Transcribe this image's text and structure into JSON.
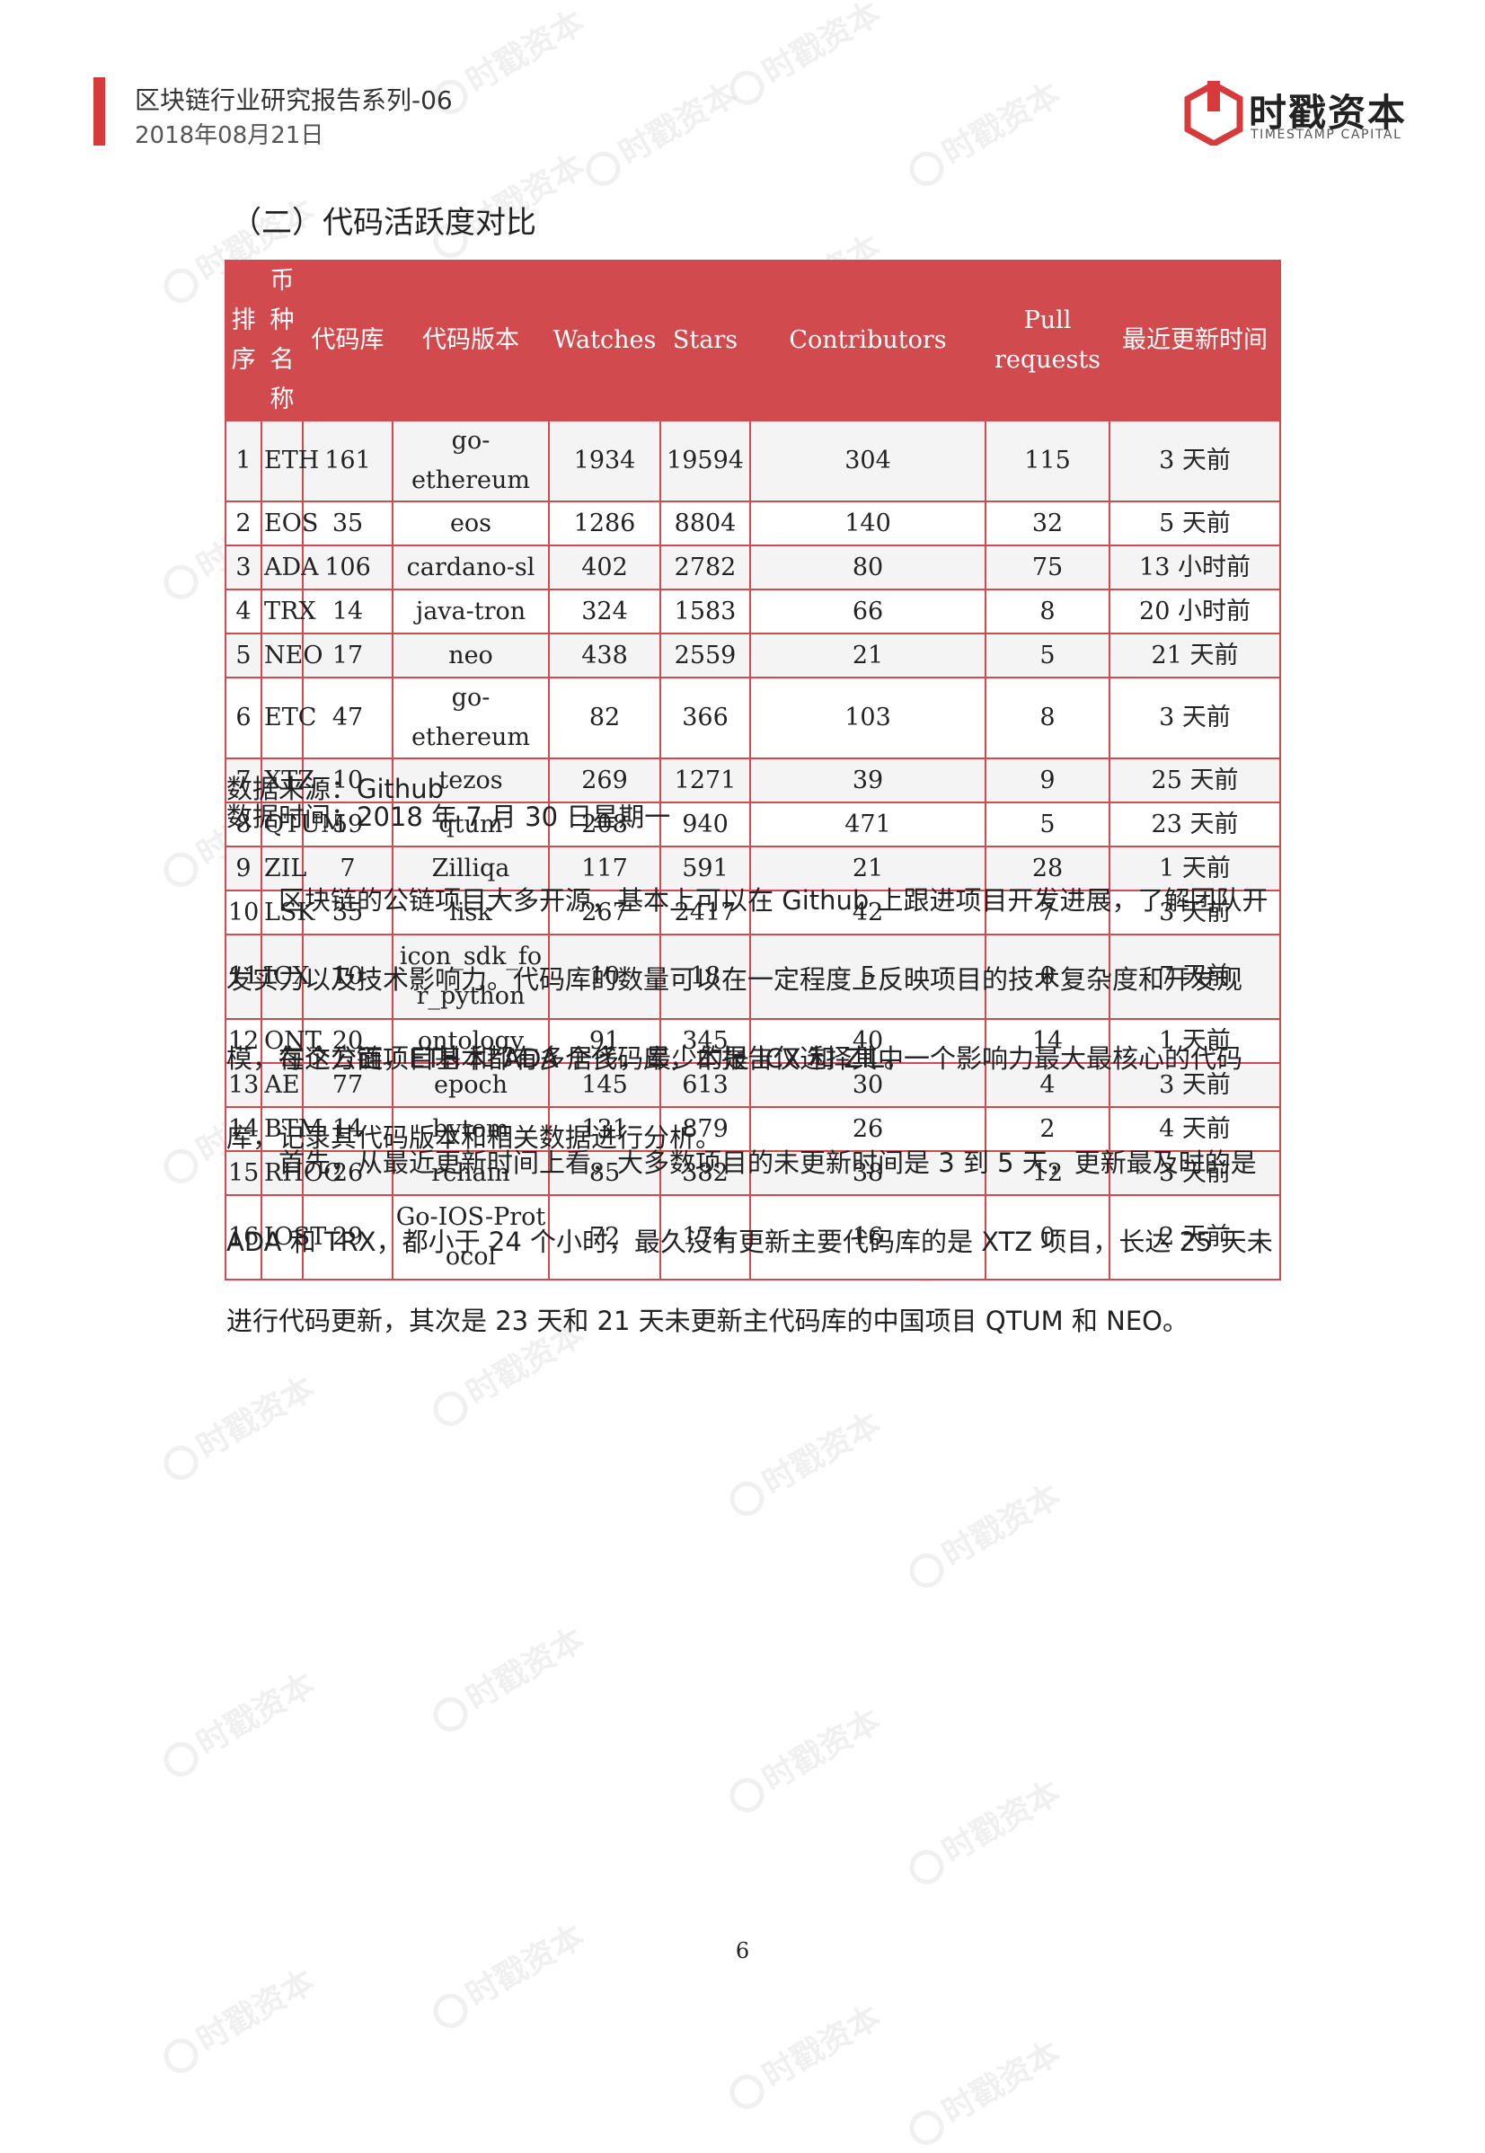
{
  "header": {
    "report_title": "区块链行业研究报告系列-06",
    "report_date": "2018年08月21日",
    "logo_text": "时戳资本",
    "logo_sub": "TIMESTAMP CAPITAL",
    "accent_color": "#d63a3a"
  },
  "section": {
    "heading": "（二）代码活跃度对比"
  },
  "table": {
    "headers": {
      "rank": [
        "排",
        "序"
      ],
      "coin": [
        "币种",
        "名称"
      ],
      "repos": "代码库",
      "repo_name": "代码版本",
      "watches": "Watches",
      "stars": "Stars",
      "contributors": "Contributors",
      "pull": [
        "Pull",
        "requests"
      ],
      "updated": "最近更新时间"
    },
    "header_color": "#d14a4e",
    "rows": [
      {
        "rank": "1",
        "coin": "ETH",
        "repos": "161",
        "repo": [
          "go-ethereum"
        ],
        "watches": "1934",
        "stars": "19594",
        "contributors": "304",
        "pull": "115",
        "updated": "3 天前"
      },
      {
        "rank": "2",
        "coin": "EOS",
        "repos": "35",
        "repo": [
          "eos"
        ],
        "watches": "1286",
        "stars": "8804",
        "contributors": "140",
        "pull": "32",
        "updated": "5 天前"
      },
      {
        "rank": "3",
        "coin": "ADA",
        "repos": "106",
        "repo": [
          "cardano-sl"
        ],
        "watches": "402",
        "stars": "2782",
        "contributors": "80",
        "pull": "75",
        "updated": "13 小时前"
      },
      {
        "rank": "4",
        "coin": "TRX",
        "repos": "14",
        "repo": [
          "java-tron"
        ],
        "watches": "324",
        "stars": "1583",
        "contributors": "66",
        "pull": "8",
        "updated": "20 小时前"
      },
      {
        "rank": "5",
        "coin": "NEO",
        "repos": "17",
        "repo": [
          "neo"
        ],
        "watches": "438",
        "stars": "2559",
        "contributors": "21",
        "pull": "5",
        "updated": "21 天前"
      },
      {
        "rank": "6",
        "coin": "ETC",
        "repos": "47",
        "repo": [
          "go-ethereum"
        ],
        "watches": "82",
        "stars": "366",
        "contributors": "103",
        "pull": "8",
        "updated": "3 天前"
      },
      {
        "rank": "7",
        "coin": "XTZ",
        "repos": "10",
        "repo": [
          "tezos"
        ],
        "watches": "269",
        "stars": "1271",
        "contributors": "39",
        "pull": "9",
        "updated": "25 天前"
      },
      {
        "rank": "8",
        "coin": "QTUM",
        "repos": "59",
        "repo": [
          "qtum"
        ],
        "watches": "208",
        "stars": "940",
        "contributors": "471",
        "pull": "5",
        "updated": "23 天前"
      },
      {
        "rank": "9",
        "coin": "ZIL",
        "repos": "7",
        "repo": [
          "Zilliqa"
        ],
        "watches": "117",
        "stars": "591",
        "contributors": "21",
        "pull": "28",
        "updated": "1 天前"
      },
      {
        "rank": "10",
        "coin": "LSK",
        "repos": "35",
        "repo": [
          "lisk"
        ],
        "watches": "267",
        "stars": "2417",
        "contributors": "42",
        "pull": "7",
        "updated": "3 天前"
      },
      {
        "rank": "11",
        "coin": "ICX",
        "repos": "10",
        "repo": [
          "icon_sdk_fo",
          "r_python"
        ],
        "watches": "10",
        "stars": "18",
        "contributors": "5",
        "pull": "0",
        "updated": "7 天前"
      },
      {
        "rank": "12",
        "coin": "ONT",
        "repos": "20",
        "repo": [
          "ontology"
        ],
        "watches": "91",
        "stars": "345",
        "contributors": "40",
        "pull": "14",
        "updated": "1 天前"
      },
      {
        "rank": "13",
        "coin": "AE",
        "repos": "77",
        "repo": [
          "epoch"
        ],
        "watches": "145",
        "stars": "613",
        "contributors": "30",
        "pull": "4",
        "updated": "3 天前"
      },
      {
        "rank": "14",
        "coin": "BTM",
        "repos": "14",
        "repo": [
          "bytom"
        ],
        "watches": "131",
        "stars": "879",
        "contributors": "26",
        "pull": "2",
        "updated": "4 天前"
      },
      {
        "rank": "15",
        "coin": "RHOC",
        "repos": "26",
        "repo": [
          "rchain"
        ],
        "watches": "85",
        "stars": "382",
        "contributors": "38",
        "pull": "12",
        "updated": "3 天前"
      },
      {
        "rank": "16",
        "coin": "IOST",
        "repos": "29",
        "repo": [
          "Go-IOS-Prot",
          "ocol"
        ],
        "watches": "72",
        "stars": "174",
        "contributors": "16",
        "pull": "0",
        "updated": "2 天前"
      }
    ]
  },
  "source_note": "数据来源：Github",
  "time_note": "数据时间：2018 年 7 月 30 日星期一",
  "paragraphs": [
    "区块链的公链项目大多开源，基本上可以在 Github 上跟进项目开发进展，了解团队开发实力以及技术影响力。代码库的数量可以在一定程度上反映项目的技术复杂度和开发规模，在这方面，ETH 和 ADA 居多，最少的是 ICX 和 ZIL。",
    "每个公链项目基本都有多个代码库，本报告仅选择其中一个影响力最大最核心的代码库，记录其代码版本和相关数据进行分析。",
    "首先，从最近更新时间上看，大多数项目的未更新时间是 3 到 5 天，更新最及时的是 ADA 和 TRX，都小于 24 个小时，最久没有更新主要代码库的是 XTZ 项目，长达 25 天未进行代码更新，其次是 23 天和 21 天未更新主代码库的中国项目 QTUM 和 NEO。"
  ],
  "page_number": "6",
  "watermark_text": "时戳资本"
}
